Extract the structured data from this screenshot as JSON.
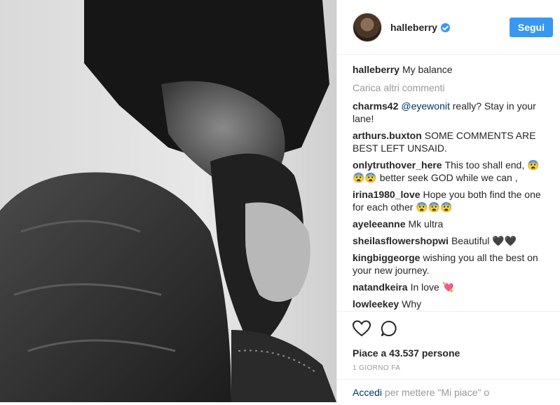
{
  "header": {
    "username": "halleberry",
    "follow_label": "Segui"
  },
  "caption": {
    "user": "halleberry",
    "text": "My balance"
  },
  "load_more": "Carica altri commenti",
  "comments": [
    {
      "user": "charms42",
      "mention": "@eyewonit",
      "text": " really? Stay in your lane!"
    },
    {
      "user": "arthurs.buxton",
      "mention": "",
      "text": "SOME COMMENTS ARE BEST LEFT UNSAID."
    },
    {
      "user": "onlytruthover_here",
      "mention": "",
      "text": "This too shall end, 😨😨😨 better seek GOD while we can ,"
    },
    {
      "user": "irina1980_love",
      "mention": "",
      "text": "Hope you both find the one for each other 😨😨😨"
    },
    {
      "user": "ayeleeanne",
      "mention": "",
      "text": "Mk ultra"
    },
    {
      "user": "sheilasflowershopwi",
      "mention": "",
      "text": "Beautiful 🖤🖤"
    },
    {
      "user": "kingbiggeorge",
      "mention": "",
      "text": "wishing you all the best on your new journey."
    },
    {
      "user": "natandkeira",
      "mention": "",
      "text": "In love 💘"
    },
    {
      "user": "lowleekey",
      "mention": "",
      "text": "Why"
    }
  ],
  "likes": "Piace a 43.537 persone",
  "timestamp": "1 GIORNO FA",
  "login": {
    "link": "Accedi",
    "text": " per mettere \"Mi piace\" o"
  },
  "icons": {
    "like": "heart-icon",
    "comment": "comment-icon"
  },
  "colors": {
    "accent": "#3897f0",
    "link": "#003569",
    "muted": "#999999"
  }
}
